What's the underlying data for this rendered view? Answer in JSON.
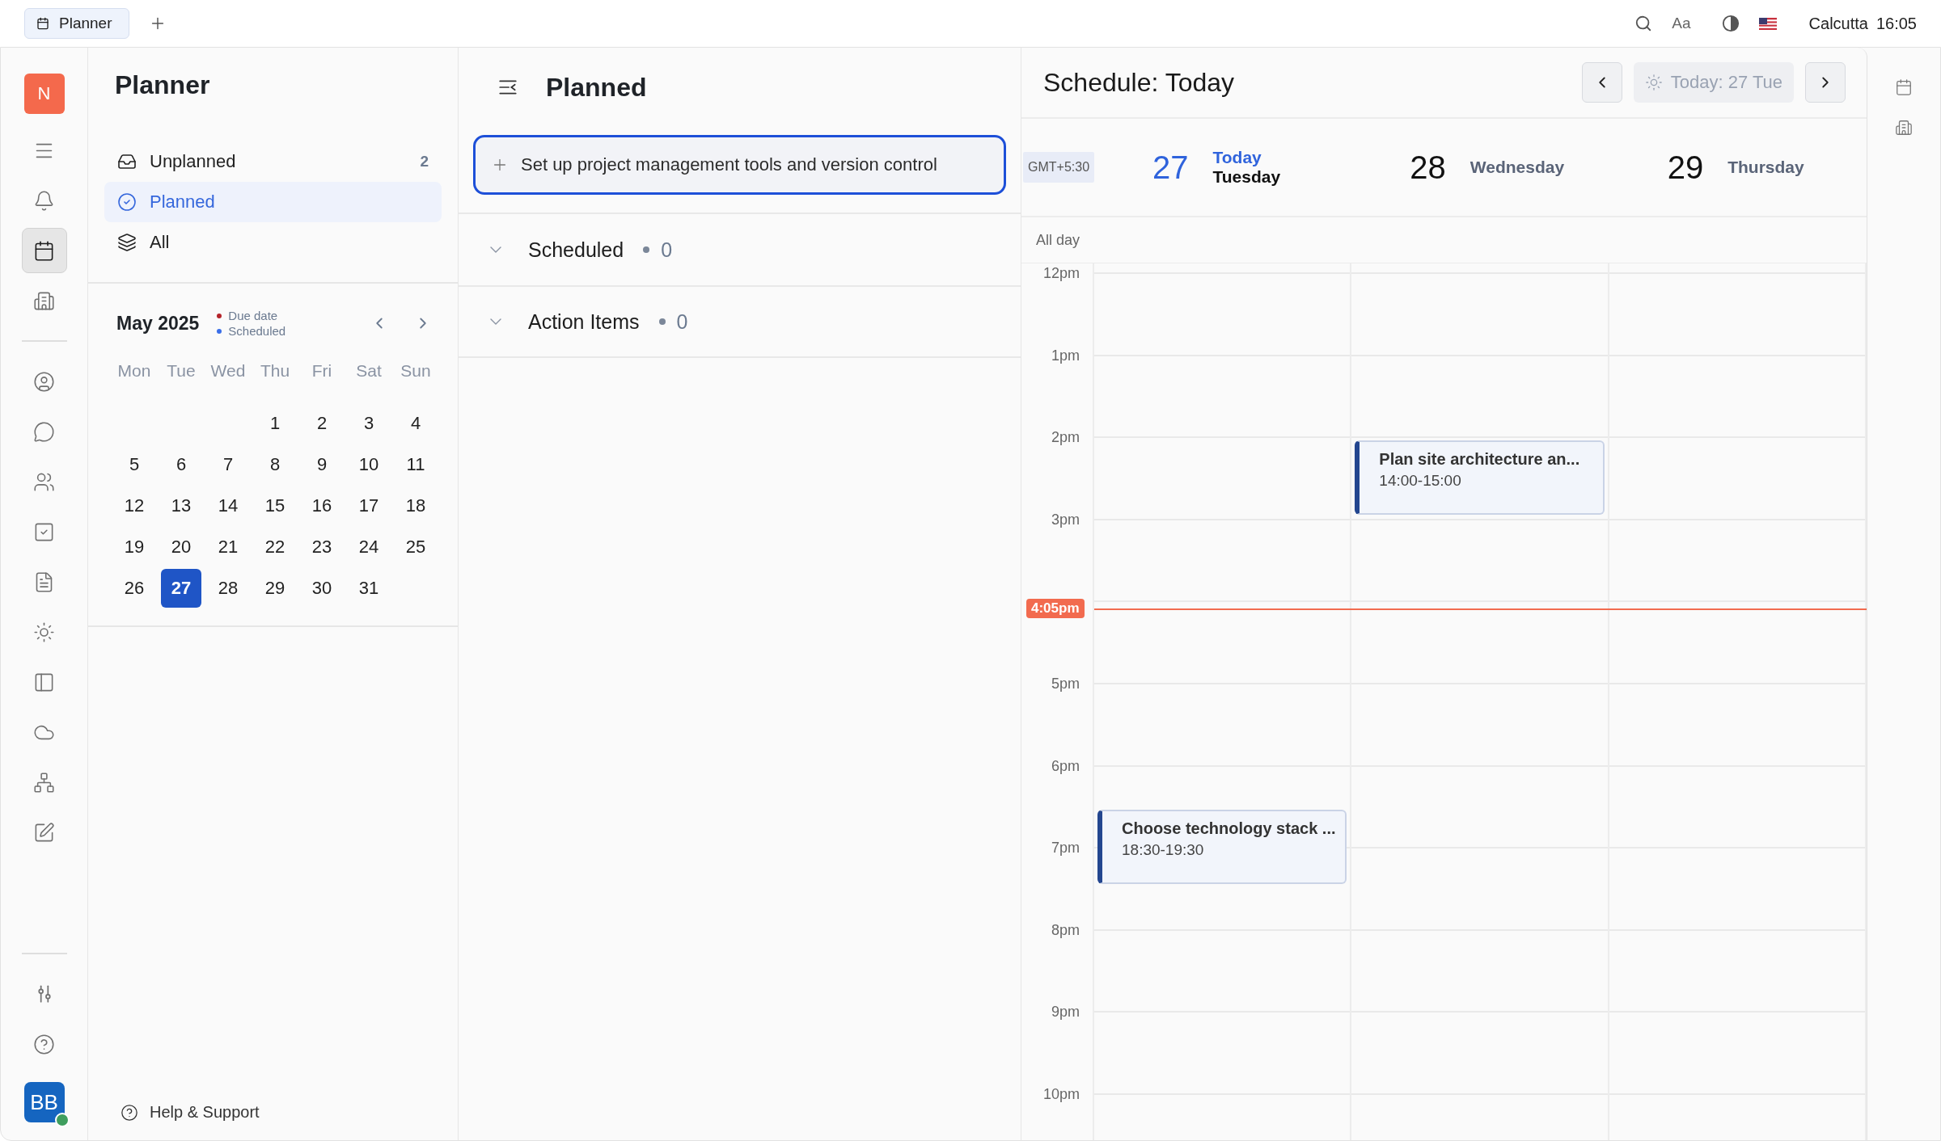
{
  "top_bar": {
    "tabs": [
      {
        "label": "Planner",
        "selected": true
      }
    ],
    "font_label": "Aa",
    "location": "Calcutta",
    "time": "16:05"
  },
  "rail": {
    "logo": "N",
    "items": [
      {
        "selected": false
      },
      {
        "selected": false
      },
      {
        "selected": true
      },
      {
        "selected": false
      },
      {
        "selected": false
      },
      {
        "selected": false
      },
      {
        "selected": false
      },
      {
        "selected": false
      },
      {
        "selected": false
      },
      {
        "selected": false
      },
      {
        "selected": false
      },
      {
        "selected": false
      },
      {
        "selected": false
      },
      {
        "selected": false
      }
    ],
    "bottom_items": [
      {
        "selected": false
      },
      {
        "selected": false
      }
    ],
    "avatar": {
      "initials": "BB",
      "online": true
    }
  },
  "planner": {
    "title": "Planner",
    "nav": [
      {
        "label": "Unplanned",
        "count": "2",
        "selected": false
      },
      {
        "label": "Planned",
        "selected": true
      },
      {
        "label": "All",
        "selected": false
      }
    ],
    "calendar": {
      "month": "May 2025",
      "legend": [
        {
          "label": "Due date",
          "color": "#b4232a"
        },
        {
          "label": "Scheduled",
          "color": "#3a6ee8"
        }
      ],
      "weekdays": [
        "Mon",
        "Tue",
        "Wed",
        "Thu",
        "Fri",
        "Sat",
        "Sun"
      ],
      "weeks": [
        [
          {
            "label": "1",
            "selected": false
          },
          {
            "label": "2",
            "selected": false
          },
          {
            "label": "3",
            "selected": false
          },
          {
            "label": "4",
            "selected": false
          }
        ],
        [
          {
            "label": "5",
            "selected": false
          },
          {
            "label": "6",
            "selected": false
          },
          {
            "label": "7",
            "selected": false
          },
          {
            "label": "8",
            "selected": false
          },
          {
            "label": "9",
            "selected": false
          },
          {
            "label": "10",
            "selected": false
          },
          {
            "label": "11",
            "selected": false
          }
        ],
        [
          {
            "label": "12",
            "selected": false
          },
          {
            "label": "13",
            "selected": false
          },
          {
            "label": "14",
            "selected": false
          },
          {
            "label": "15",
            "selected": false
          },
          {
            "label": "16",
            "selected": false
          },
          {
            "label": "17",
            "selected": false
          },
          {
            "label": "18",
            "selected": false
          }
        ],
        [
          {
            "label": "19",
            "selected": false
          },
          {
            "label": "20",
            "selected": false
          },
          {
            "label": "21",
            "selected": false
          },
          {
            "label": "22",
            "selected": false
          },
          {
            "label": "23",
            "selected": false
          },
          {
            "label": "24",
            "selected": false
          },
          {
            "label": "25",
            "selected": false
          }
        ],
        [
          {
            "label": "26",
            "selected": false
          },
          {
            "label": "27",
            "selected": true
          },
          {
            "label": "28",
            "selected": false
          },
          {
            "label": "29",
            "selected": false
          },
          {
            "label": "30",
            "selected": false
          },
          {
            "label": "31",
            "selected": false
          }
        ]
      ]
    },
    "help": "Help & Support"
  },
  "list": {
    "title": "Planned",
    "new_task": {
      "value": "Set up project management tools and version control",
      "focused": true
    },
    "sections": [
      {
        "label": "Scheduled",
        "count": "0"
      },
      {
        "label": "Action Items",
        "count": "0"
      }
    ]
  },
  "schedule": {
    "title": "Schedule: Today",
    "today_button": "Today: 27 Tue",
    "timezone": "GMT+5:30",
    "all_day": "All day",
    "days": [
      {
        "number": "27",
        "today_label": "Today",
        "weekday": "Tuesday",
        "today": true,
        "events": [
          {
            "title": "Choose technology stack ...",
            "time": "18:30-19:30"
          }
        ]
      },
      {
        "number": "28",
        "weekday": "Wednesday",
        "today": false,
        "events": [
          {
            "title": "Plan site architecture an...",
            "time": "14:00-15:00"
          }
        ]
      },
      {
        "number": "29",
        "weekday": "Thursday",
        "today": false
      }
    ],
    "hours": [
      "12pm",
      "1pm",
      "2pm",
      "3pm",
      "5pm",
      "6pm",
      "7pm",
      "8pm",
      "9pm",
      "10pm"
    ],
    "now": "4:05pm"
  }
}
